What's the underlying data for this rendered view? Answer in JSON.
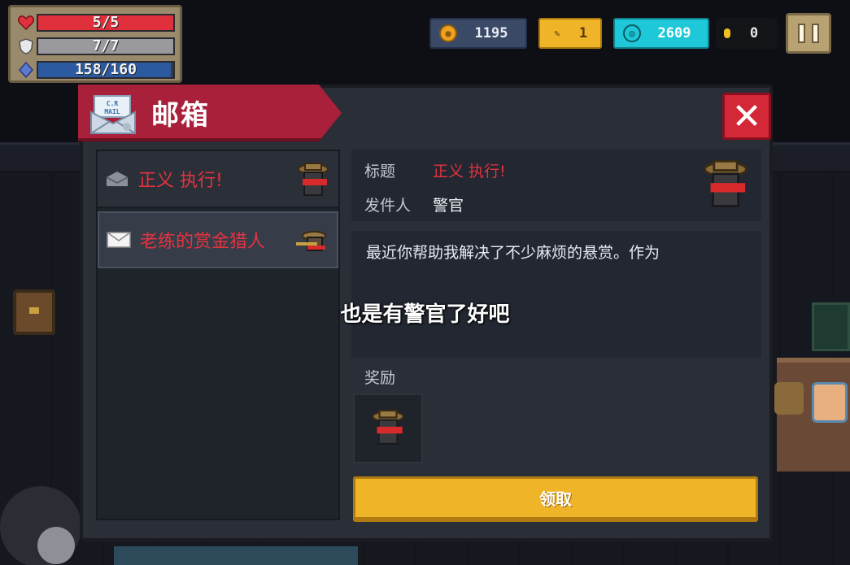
{
  "hud": {
    "hp": {
      "text": "5/5",
      "fraction": 1.0,
      "color": "#e0303c"
    },
    "armor": {
      "text": "7/7",
      "fraction": 1.0,
      "color": "#9a9a9e"
    },
    "energy": {
      "text": "158/160",
      "fraction": 0.98,
      "color": "#2c5aa0"
    },
    "coins": "1195",
    "material": "1",
    "gems": "2609",
    "seeds": "0"
  },
  "mail": {
    "title": "邮箱",
    "items": [
      {
        "subject": "正义 执行!",
        "state": "read"
      },
      {
        "subject": "老练的赏金猎人",
        "state": "unread"
      }
    ],
    "detail": {
      "title_label": "标题",
      "title_value": "正义 执行!",
      "sender_label": "发件人",
      "sender_value": "警官",
      "body": "最近你帮助我解决了不少麻烦的悬赏。作为",
      "reward_label": "奖励",
      "claim_label": "领取"
    }
  },
  "subtitle": "也是有警官了好吧",
  "colors": {
    "accent_red": "#a8203a",
    "subject_red": "#e4333f",
    "claim_yellow": "#f0b429"
  }
}
